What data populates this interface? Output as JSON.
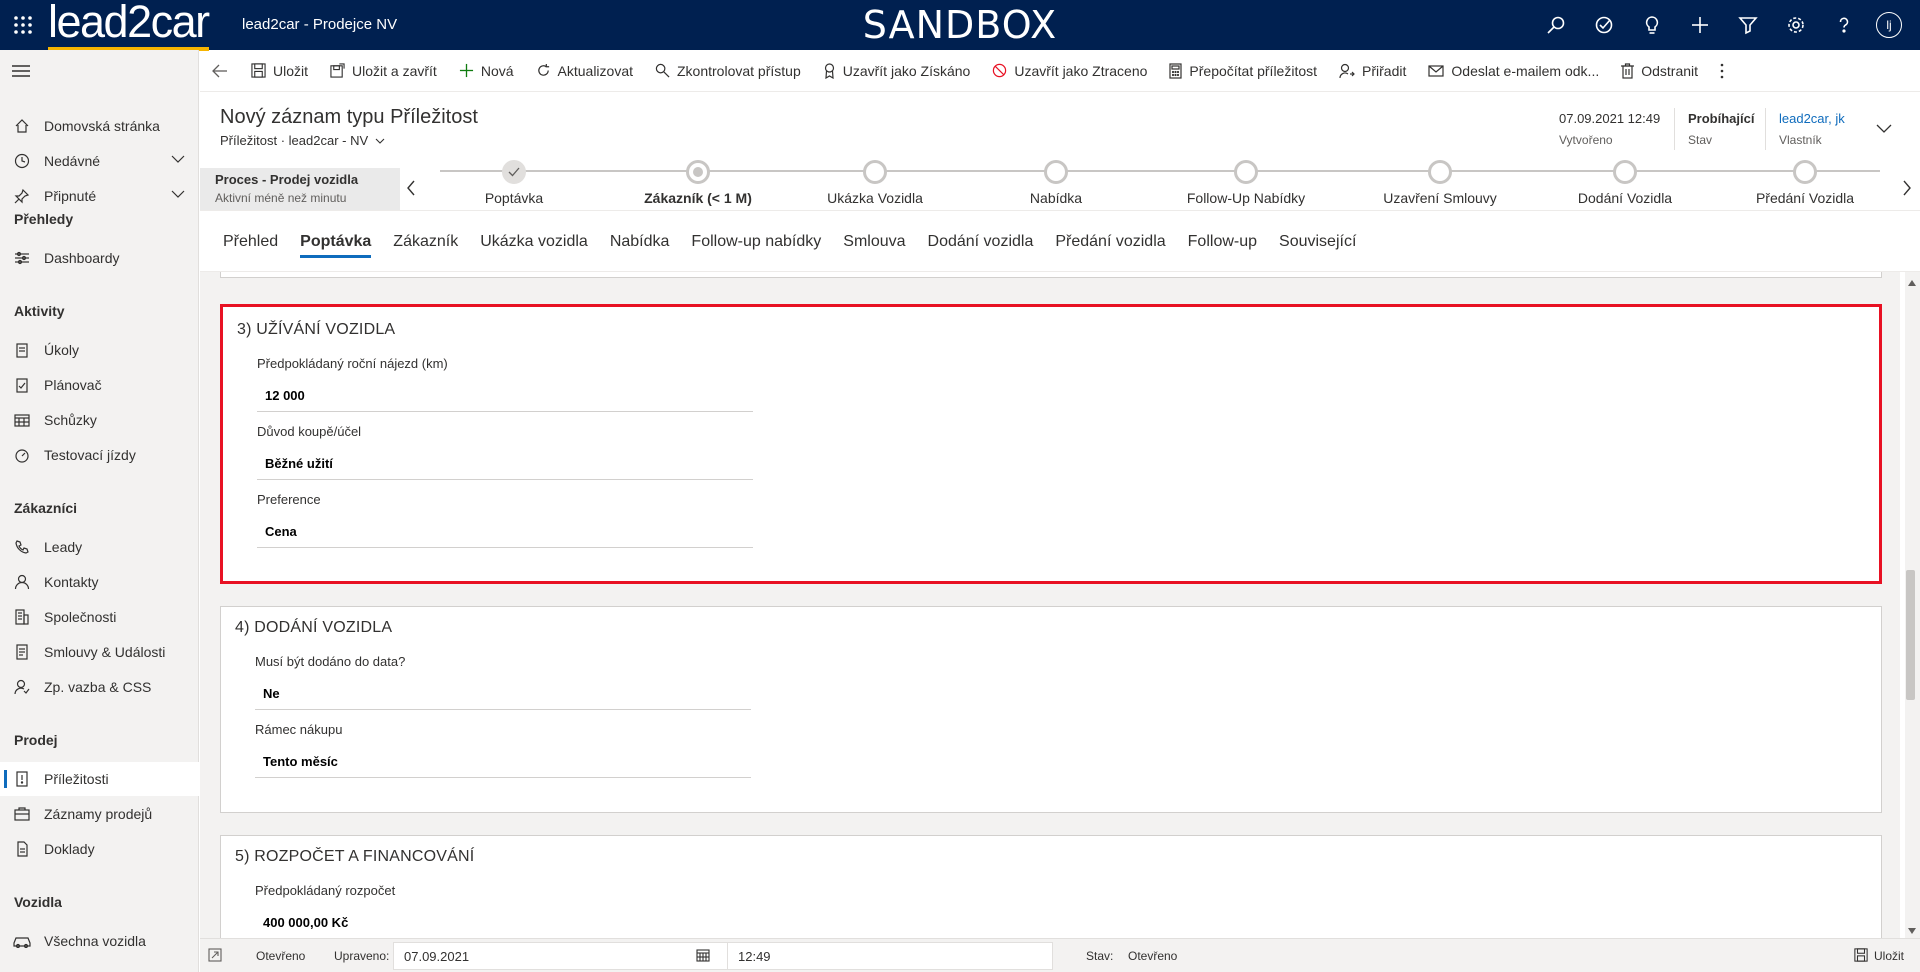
{
  "topbar": {
    "logo": "lead2car",
    "app_name": "lead2car - Prodejce NV",
    "environment": "SANDBOX",
    "avatar_initials": "lj",
    "colors": {
      "background": "#002050",
      "logo_underline": "#f6b400"
    }
  },
  "sidebar": {
    "items": [
      {
        "label": "Domovská stránka",
        "icon": "home-icon"
      },
      {
        "label": "Nedávné",
        "icon": "clock-icon"
      },
      {
        "label": "Připnuté",
        "icon": "pin-icon"
      }
    ],
    "groups": [
      {
        "title": "Přehledy",
        "items": [
          {
            "label": "Dashboardy",
            "icon": "dashboard-icon"
          }
        ]
      },
      {
        "title": "Aktivity",
        "items": [
          {
            "label": "Úkoly",
            "icon": "task-icon"
          },
          {
            "label": "Plánovač",
            "icon": "planner-icon"
          },
          {
            "label": "Schůzky",
            "icon": "calendar-icon"
          },
          {
            "label": "Testovací jízdy",
            "icon": "speedometer-icon"
          }
        ]
      },
      {
        "title": "Zákazníci",
        "items": [
          {
            "label": "Leady",
            "icon": "phone-icon"
          },
          {
            "label": "Kontakty",
            "icon": "person-icon"
          },
          {
            "label": "Společnosti",
            "icon": "building-icon"
          },
          {
            "label": "Smlouvy & Události",
            "icon": "contract-icon"
          },
          {
            "label": "Zp. vazba & CSS",
            "icon": "feedback-icon"
          }
        ]
      },
      {
        "title": "Prodej",
        "items": [
          {
            "label": "Příležitosti",
            "icon": "opportunity-icon",
            "active": true
          },
          {
            "label": "Záznamy prodejů",
            "icon": "sales-records-icon"
          },
          {
            "label": "Doklady",
            "icon": "document-icon"
          }
        ]
      },
      {
        "title": "Vozidla",
        "items": [
          {
            "label": "Všechna vozidla",
            "icon": "car-icon"
          }
        ]
      }
    ]
  },
  "commandbar": {
    "save": "Uložit",
    "save_close": "Uložit a zavřít",
    "new": "Nová",
    "refresh": "Aktualizovat",
    "check_access": "Zkontrolovat přístup",
    "close_won": "Uzavřít jako Získáno",
    "close_lost": "Uzavřít jako Ztraceno",
    "recalc": "Přepočítat příležitost",
    "assign": "Přiřadit",
    "email": "Odeslat e-mailem odk...",
    "delete": "Odstranit"
  },
  "header": {
    "title": "Nový záznam typu Příležitost",
    "entity": "Příležitost",
    "form": "lead2car - NV",
    "created_value": "07.09.2021 12:49",
    "created_label": "Vytvořeno",
    "status_value": "Probíhající",
    "status_label": "Stav",
    "owner_value": "lead2car, jk",
    "owner_label": "Vlastník"
  },
  "process": {
    "name": "Proces - Prodej vozidla",
    "active_time": "Aktivní méně než minutu",
    "stages": [
      {
        "label": "Poptávka",
        "state": "done"
      },
      {
        "label": "Zákazník  (< 1 M)",
        "state": "current"
      },
      {
        "label": "Ukázka Vozidla",
        "state": "todo"
      },
      {
        "label": "Nabídka",
        "state": "todo"
      },
      {
        "label": "Follow-Up Nabídky",
        "state": "todo"
      },
      {
        "label": "Uzavření Smlouvy",
        "state": "todo"
      },
      {
        "label": "Dodání Vozidla",
        "state": "todo"
      },
      {
        "label": "Předání Vozidla",
        "state": "todo"
      }
    ]
  },
  "tabs": [
    "Přehled",
    "Poptávka",
    "Zákazník",
    "Ukázka vozidla",
    "Nabídka",
    "Follow-up nabídky",
    "Smlouva",
    "Dodání vozidla",
    "Předání vozidla",
    "Follow-up",
    "Související"
  ],
  "selected_tab": "Poptávka",
  "sections": [
    {
      "title": "3) UŽÍVÁNÍ VOZIDLA",
      "highlight_color": "#e81123",
      "fields": [
        {
          "label": "Předpokládaný roční nájezd (km)",
          "value": "12 000"
        },
        {
          "label": "Důvod koupě/účel",
          "value": "Běžné užití"
        },
        {
          "label": "Preference",
          "value": "Cena"
        }
      ]
    },
    {
      "title": "4) DODÁNÍ VOZIDLA",
      "fields": [
        {
          "label": "Musí být dodáno do data?",
          "value": "Ne"
        },
        {
          "label": "Rámec nákupu",
          "value": "Tento měsíc"
        }
      ]
    },
    {
      "title": "5) ROZPOČET A FINANCOVÁNÍ",
      "fields": [
        {
          "label": "Předpokládaný rozpočet",
          "value": "400 000,00 Kč"
        }
      ]
    }
  ],
  "statusbar": {
    "state_left": "Otevřeno",
    "modified_label": "Upraveno:",
    "modified_date": "07.09.2021",
    "modified_time": "12:49",
    "status_label": "Stav:",
    "status_value": "Otevřeno",
    "save": "Uložit"
  }
}
